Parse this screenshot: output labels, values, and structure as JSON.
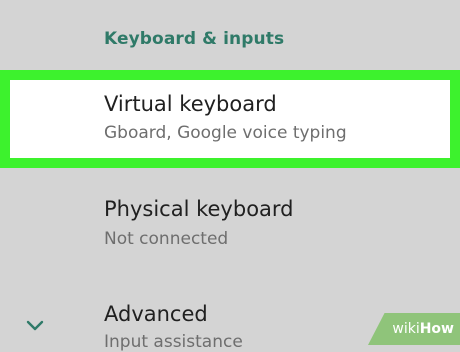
{
  "section": {
    "header": "Keyboard & inputs"
  },
  "items": [
    {
      "title": "Virtual keyboard",
      "subtitle": "Gboard, Google voice typing",
      "highlighted": true
    },
    {
      "title": "Physical keyboard",
      "subtitle": "Not connected"
    },
    {
      "title": "Advanced",
      "subtitle": "Input assistance"
    }
  ],
  "icons": {
    "expand": "chevron-down-icon"
  },
  "watermark": {
    "wiki": "wiki",
    "how": "How"
  },
  "colors": {
    "highlight": "#3df22d",
    "section_header": "#2f7a68",
    "background": "#d4d4d4",
    "watermark": "#8fc47a"
  }
}
